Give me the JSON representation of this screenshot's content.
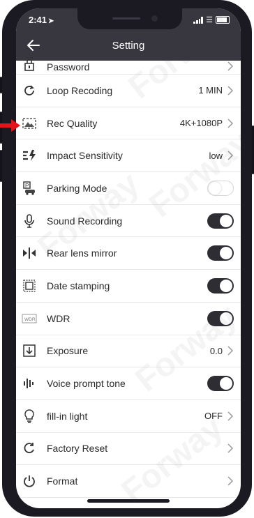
{
  "status_bar": {
    "time": "2:41",
    "location_icon": "location-arrow-icon"
  },
  "header": {
    "title": "Setting",
    "back_icon": "back-arrow-icon"
  },
  "rows": [
    {
      "label": "Password",
      "icon": "lock-icon",
      "control": "chevron"
    },
    {
      "label": "Loop Recoding",
      "icon": "loop-icon",
      "value": "1 MIN",
      "control": "chevron"
    },
    {
      "label": "Rec Quality",
      "icon": "quality-icon",
      "value": "4K+1080P",
      "control": "chevron"
    },
    {
      "label": "Impact Sensitivity",
      "icon": "impact-icon",
      "value": "low",
      "control": "chevron"
    },
    {
      "label": "Parking Mode",
      "icon": "parking-icon",
      "control": "toggle",
      "state": false
    },
    {
      "label": "Sound Recording",
      "icon": "microphone-icon",
      "control": "toggle",
      "state": true
    },
    {
      "label": "Rear lens mirror",
      "icon": "mirror-icon",
      "control": "toggle",
      "state": true
    },
    {
      "label": "Date stamping",
      "icon": "date-stamp-icon",
      "control": "toggle",
      "state": true
    },
    {
      "label": "WDR",
      "icon": "wdr-icon",
      "control": "toggle",
      "state": true
    },
    {
      "label": "Exposure",
      "icon": "exposure-icon",
      "value": "0.0",
      "control": "chevron"
    },
    {
      "label": "Voice prompt tone",
      "icon": "voice-tone-icon",
      "control": "toggle",
      "state": true
    },
    {
      "label": "fill-in light",
      "icon": "lightbulb-icon",
      "value": "OFF",
      "control": "chevron"
    },
    {
      "label": "Factory Reset",
      "icon": "reset-icon",
      "control": "chevron"
    },
    {
      "label": "Format",
      "icon": "power-icon",
      "control": "chevron"
    }
  ],
  "watermark": "Forway",
  "colors": {
    "header_bg": "#38363f",
    "toggle_on": "#2e2d33",
    "phone_frame": "#1b1a22",
    "pointer_arrow": "#e3121b"
  }
}
